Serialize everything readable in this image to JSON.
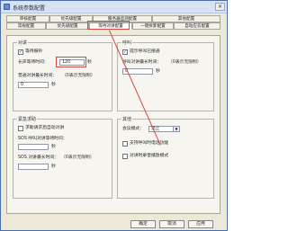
{
  "window": {
    "title": "系统参数配置",
    "close_glyph": "×"
  },
  "tabs_top": [
    "审核配置",
    "优先级配置",
    "服务器监测配置",
    "其他配置"
  ],
  "tabs_bottom": [
    "常规配置",
    "优先级配置",
    "等待对讲配置",
    "一键拆卸配置",
    "自动应答配置"
  ],
  "sections": {
    "talk": {
      "title": "对讲",
      "wait_enable": "等待振铃",
      "wait_time_label": "长声等待时间：",
      "wait_time_value": "120",
      "wait_unit": "秒",
      "normal_talk_label": "普通对讲最长时间：",
      "normal_talk_hint": "（0表示无限制）",
      "normal_talk_value": "0",
      "normal_talk_unit": "秒"
    },
    "ring": {
      "title": "呼叫",
      "enable": "提示呼叫已接通",
      "max_label": "呼叫对讲最长时间：",
      "max_hint": "（0表示无限制）",
      "max_value": "0",
      "max_unit": "秒"
    },
    "emergency": {
      "title": "紧急求助",
      "request_enable": "求助请求后自动对讲",
      "sos_label": "SOS 呼叫对讲等待时间：",
      "sos_value": "",
      "sos_unit": "秒",
      "sos_max_label": "SOS 对讲最长时间：",
      "sos_max_hint": "（0表示无限制）",
      "sos_max_value": "",
      "sos_max_unit": "秒"
    },
    "others": {
      "title": "其他",
      "mode_label": "会议模式：",
      "mode_value": "禁止",
      "option1": "支持呼叫时电话功能",
      "option2": "对讲时录音播放模式"
    }
  },
  "buttons": {
    "ok": "确定",
    "cancel": "取消",
    "apply": "应用"
  }
}
